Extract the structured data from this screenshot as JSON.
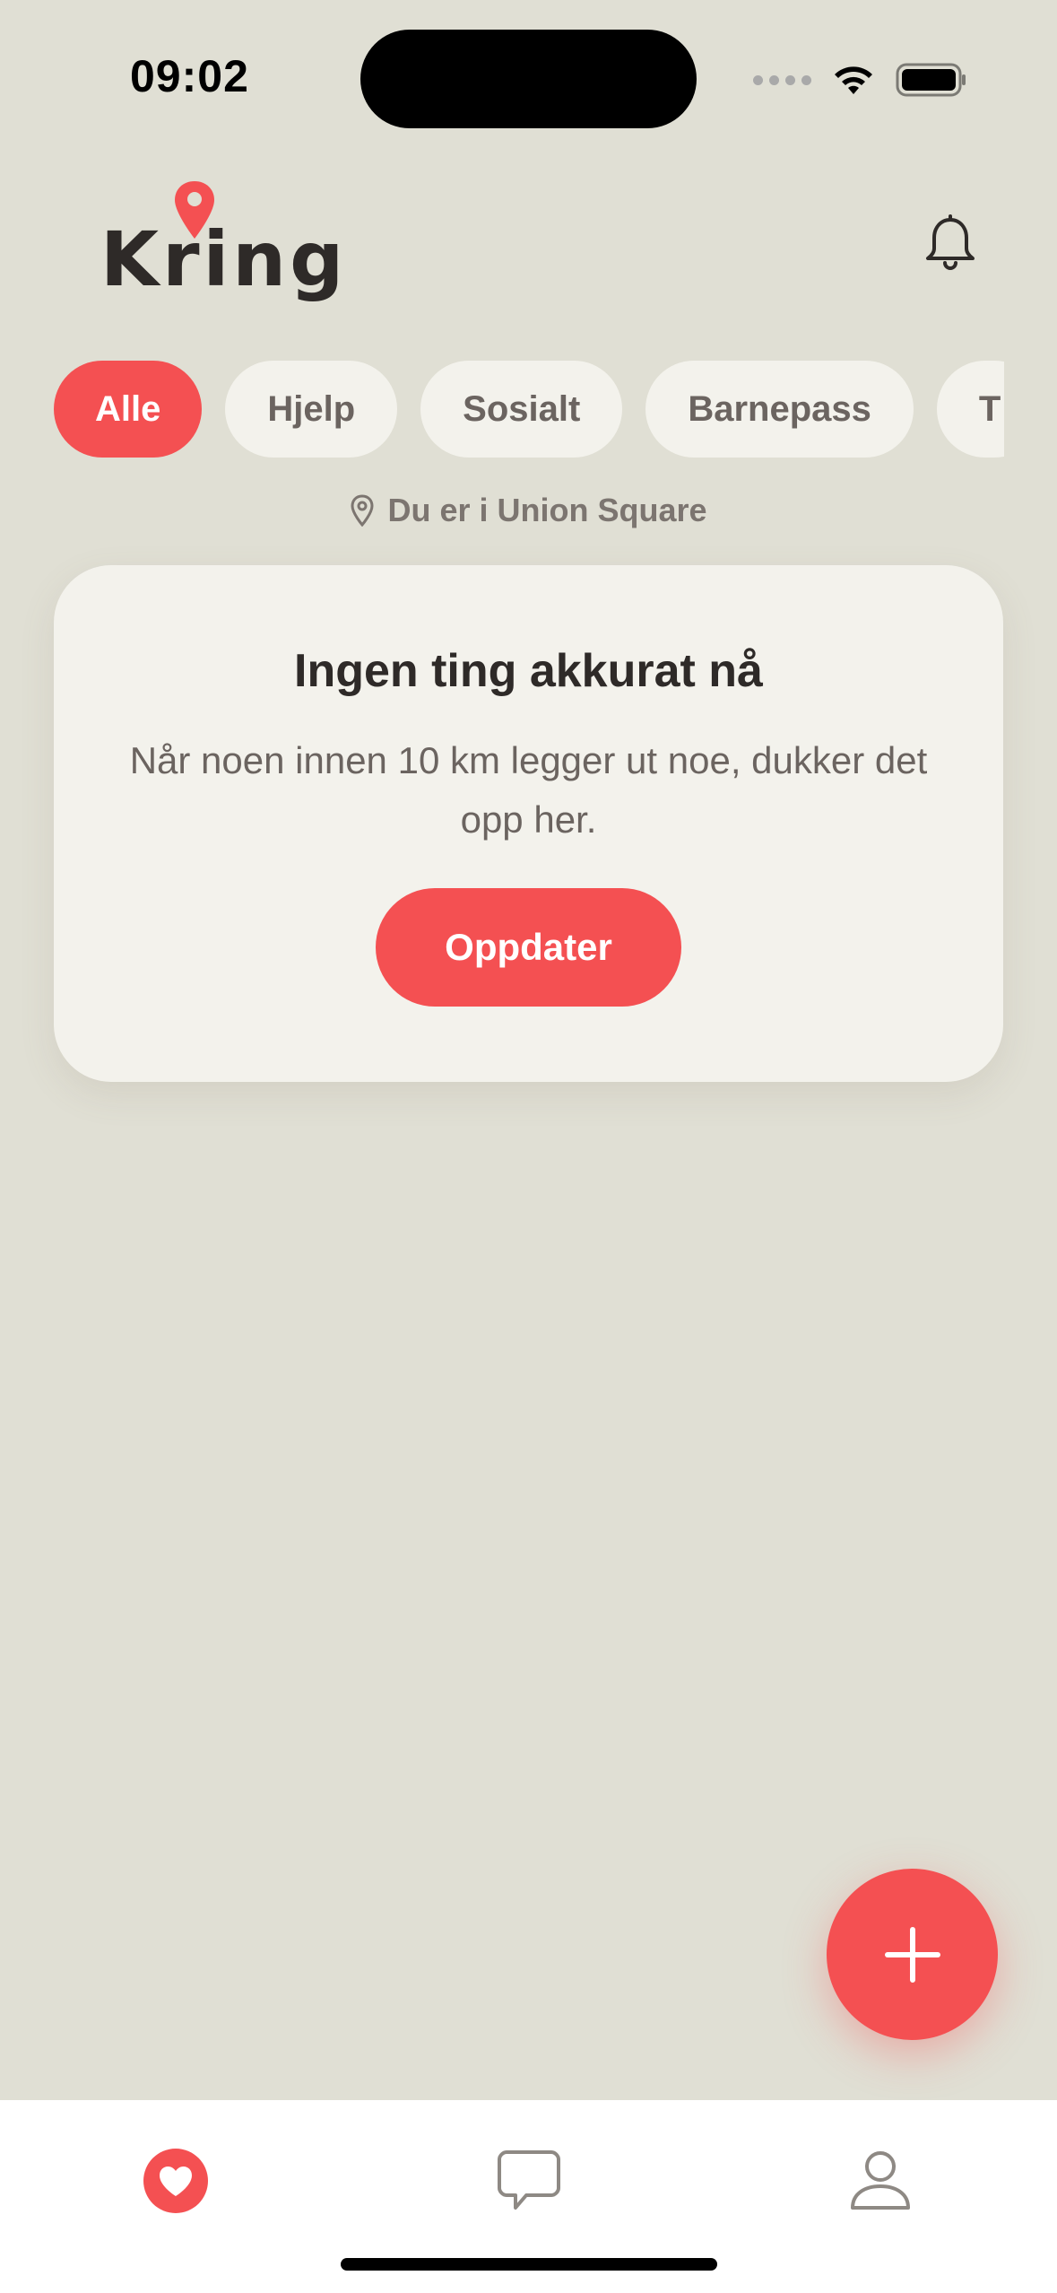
{
  "status_bar": {
    "time": "09:02",
    "icons": [
      "cellular-signal-icon",
      "wifi-icon",
      "battery-icon"
    ]
  },
  "header": {
    "logo_text": "Kring",
    "logo_icon": "map-pin-icon",
    "notifications_icon": "bell-icon"
  },
  "filters": {
    "chips": [
      {
        "label": "Alle",
        "active": true
      },
      {
        "label": "Hjelp",
        "active": false
      },
      {
        "label": "Sosialt",
        "active": false
      },
      {
        "label": "Barnepass",
        "active": false
      },
      {
        "label": "T",
        "active": false
      }
    ]
  },
  "location": {
    "icon": "location-pin-icon",
    "text": "Du er i Union Square"
  },
  "empty_state": {
    "title": "Ingen ting akkurat nå",
    "body": "Når noen innen 10 km legger ut noe, dukker det opp her.",
    "button_label": "Oppdater"
  },
  "fab": {
    "icon": "plus-icon"
  },
  "tabbar": {
    "tabs": [
      {
        "icon": "heart-icon",
        "active": true
      },
      {
        "icon": "chat-bubble-icon",
        "active": false
      },
      {
        "icon": "profile-icon",
        "active": false
      }
    ]
  },
  "colors": {
    "accent": "#F45052",
    "background": "#E0DFD4",
    "card": "#F3F2EC",
    "text_dark": "#2E2A28",
    "text_muted": "#6B6460"
  }
}
